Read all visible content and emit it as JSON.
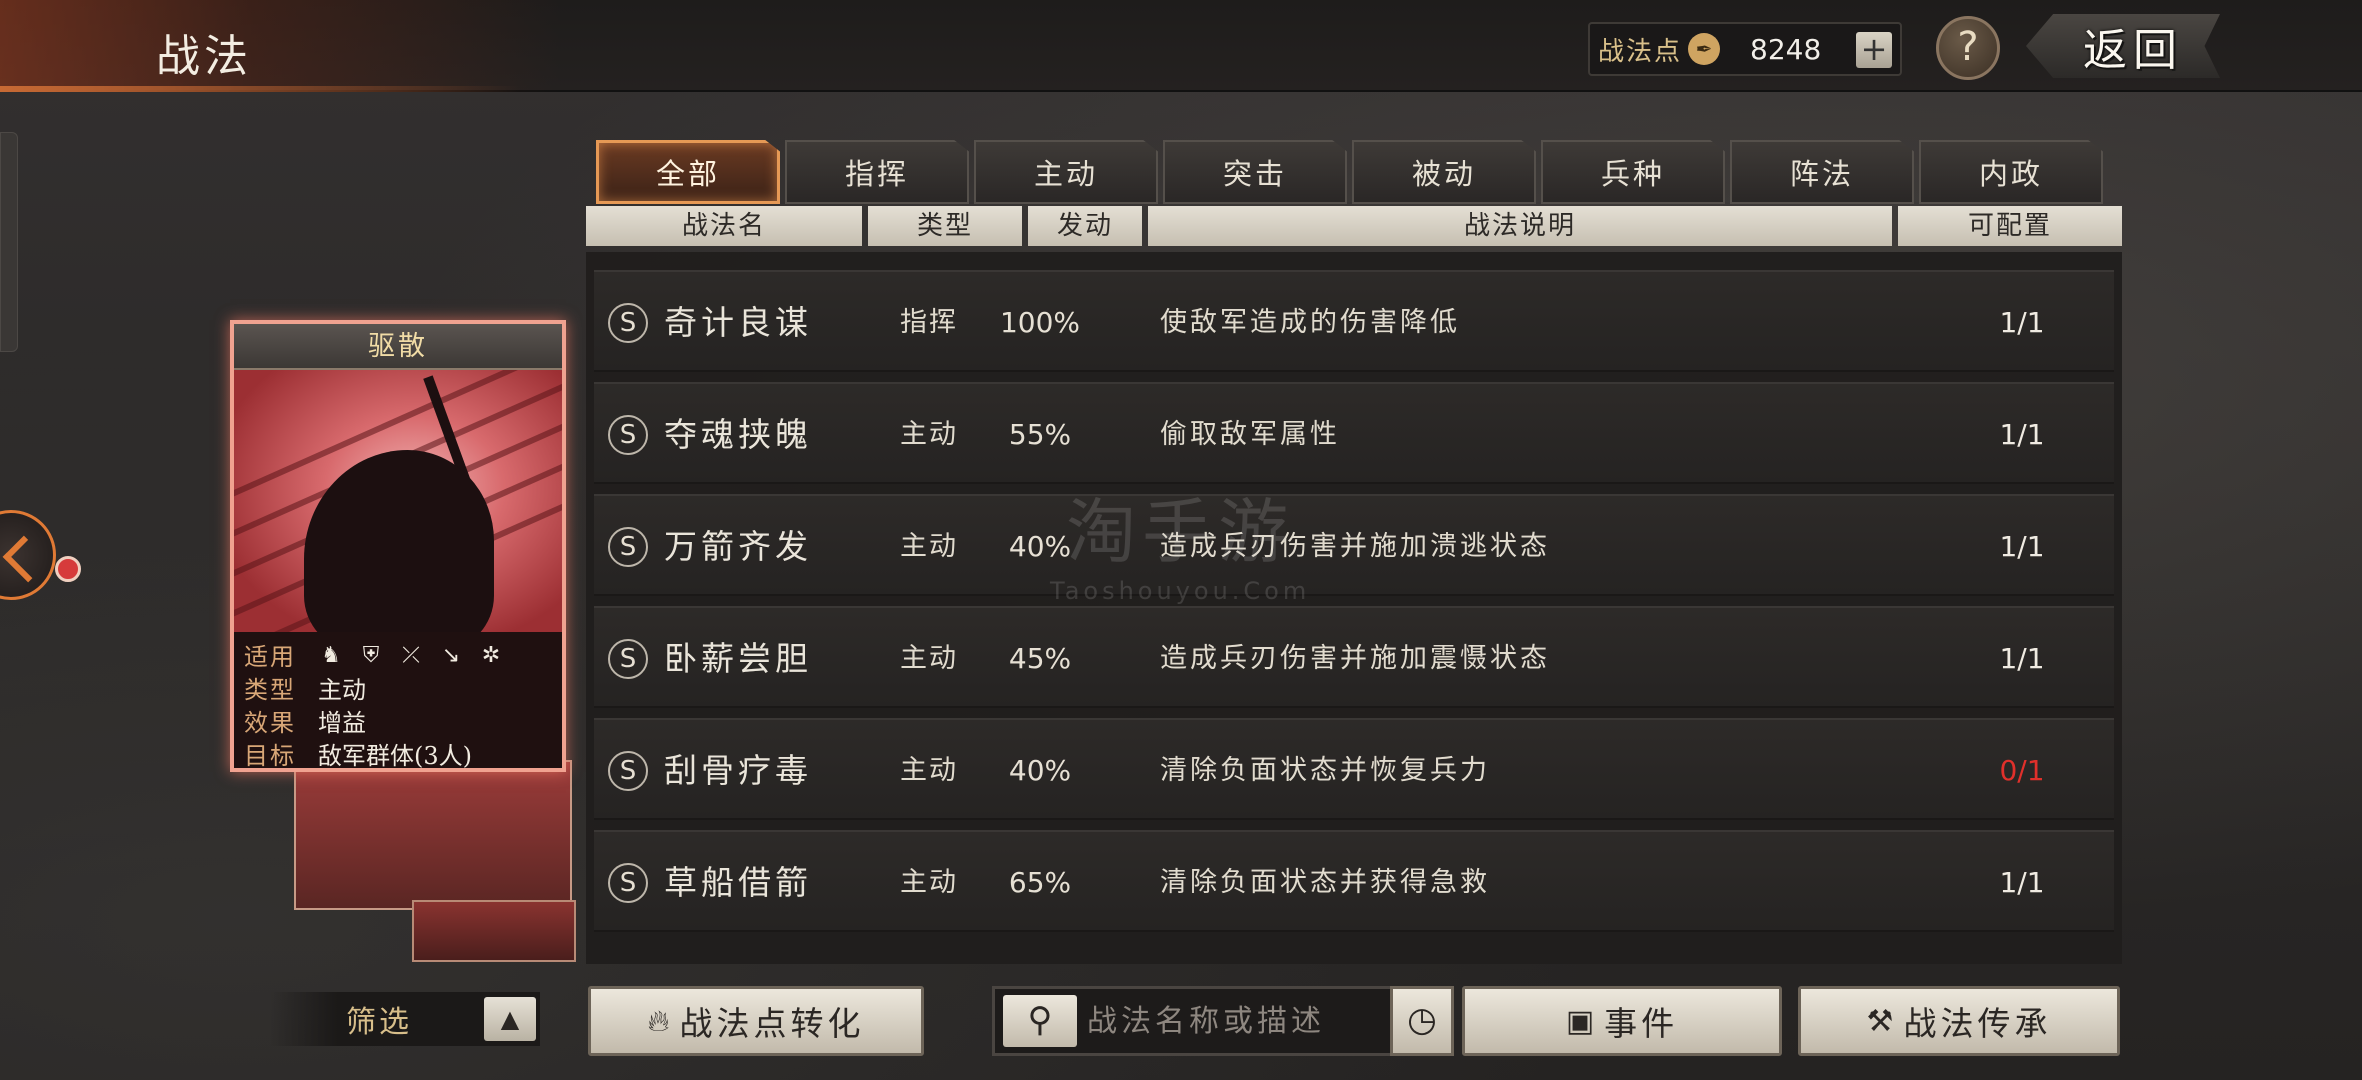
{
  "header": {
    "title": "战法",
    "points_label": "战法点",
    "points_value": "8248",
    "plus_label": "+",
    "help_label": "?",
    "back_label": "返回"
  },
  "tabs": [
    {
      "label": "全部",
      "active": true
    },
    {
      "label": "指挥",
      "active": false
    },
    {
      "label": "主动",
      "active": false
    },
    {
      "label": "突击",
      "active": false
    },
    {
      "label": "被动",
      "active": false
    },
    {
      "label": "兵种",
      "active": false
    },
    {
      "label": "阵法",
      "active": false
    },
    {
      "label": "内政",
      "active": false
    }
  ],
  "columns": {
    "name": "战法名",
    "type": "类型",
    "rate": "发动",
    "desc": "战法说明",
    "config": "可配置"
  },
  "rows": [
    {
      "grade": "S",
      "name": "奇计良谋",
      "type": "指挥",
      "rate": "100%",
      "desc": "使敌军造成的伤害降低",
      "config": "1/1",
      "config_red": false
    },
    {
      "grade": "S",
      "name": "夺魂挟魄",
      "type": "主动",
      "rate": "55%",
      "desc": "偷取敌军属性",
      "config": "1/1",
      "config_red": false
    },
    {
      "grade": "S",
      "name": "万箭齐发",
      "type": "主动",
      "rate": "40%",
      "desc": "造成兵刃伤害并施加溃逃状态",
      "config": "1/1",
      "config_red": false
    },
    {
      "grade": "S",
      "name": "卧薪尝胆",
      "type": "主动",
      "rate": "45%",
      "desc": "造成兵刃伤害并施加震慑状态",
      "config": "1/1",
      "config_red": false
    },
    {
      "grade": "S",
      "name": "刮骨疗毒",
      "type": "主动",
      "rate": "40%",
      "desc": "清除负面状态并恢复兵力",
      "config": "0/1",
      "config_red": true
    },
    {
      "grade": "S",
      "name": "草船借箭",
      "type": "主动",
      "rate": "65%",
      "desc": "清除负面状态并获得急救",
      "config": "1/1",
      "config_red": false
    }
  ],
  "card": {
    "title": "驱散",
    "apply_label": "适用",
    "type_label": "类型",
    "type_value": "主动",
    "effect_label": "效果",
    "effect_value": "增益",
    "target_label": "目标",
    "target_value": "敌军群体(3人)",
    "unit_icons": [
      "cavalry-icon",
      "shield-icon",
      "bow-icon",
      "spear-icon",
      "siege-icon"
    ]
  },
  "filter": {
    "label": "筛选",
    "arrow": "▲"
  },
  "bottom": {
    "convert_label": "战法点转化",
    "search_placeholder": "战法名称或描述",
    "event_label": "事件",
    "inherit_label": "战法传承"
  },
  "watermark": {
    "big": "淘手游",
    "small": "Taoshouyou.Com"
  },
  "colors": {
    "accent_orange": "#e69955",
    "config_red": "#e0302b",
    "card_border": "#f0a290"
  }
}
